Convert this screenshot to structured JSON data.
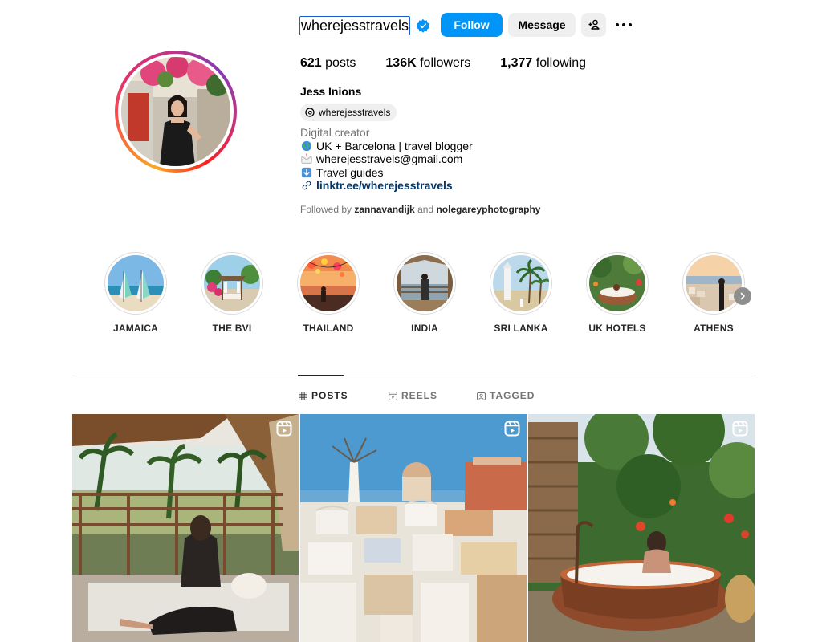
{
  "profile": {
    "username": "wherejesstravels",
    "follow_label": "Follow",
    "message_label": "Message",
    "stats": {
      "posts_count": "621",
      "posts_label": "posts",
      "followers_count": "136K",
      "followers_label": "followers",
      "following_count": "1,377",
      "following_label": "following"
    },
    "full_name": "Jess Inions",
    "threads_handle": "wherejesstravels",
    "category": "Digital creator",
    "bio_lines": [
      "UK + Barcelona | travel blogger",
      "wherejesstravels@gmail.com",
      "Travel guides"
    ],
    "link": "linktr.ee/wherejesstravels",
    "followed_by_prefix": "Followed by",
    "followed_by_user1": "zannavandijk",
    "followed_by_and": "and",
    "followed_by_user2": "nolegareyphotography"
  },
  "highlights": [
    {
      "label": "JAMAICA"
    },
    {
      "label": "THE BVI"
    },
    {
      "label": "THAILAND"
    },
    {
      "label": "INDIA"
    },
    {
      "label": "SRI LANKA"
    },
    {
      "label": "UK HOTELS"
    },
    {
      "label": "ATHENS"
    }
  ],
  "tabs": [
    {
      "label": "POSTS",
      "active": true
    },
    {
      "label": "REELS",
      "active": false
    },
    {
      "label": "TAGGED",
      "active": false
    }
  ],
  "colors": {
    "accent": "#0095f6",
    "verified": "#0095f6",
    "link": "#00376b"
  },
  "icons": [
    "verified-badge-icon",
    "add-user-icon",
    "more-options-icon",
    "threads-icon",
    "globe-icon",
    "envelope-icon",
    "down-arrow-icon",
    "link-icon",
    "chevron-right-icon",
    "grid-icon",
    "reels-icon",
    "tagged-icon",
    "reel-indicator-icon"
  ]
}
